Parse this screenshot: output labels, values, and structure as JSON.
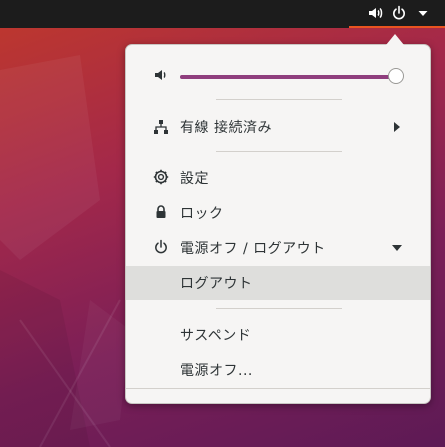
{
  "topbar": {
    "icons": [
      "volume-icon",
      "power-icon",
      "chevron-down-icon"
    ],
    "accent_color": "#e95420",
    "background_color": "#1c1c1c"
  },
  "menu": {
    "volume": {
      "icon": "volume-icon",
      "level": 0.99,
      "fill_color": "#8f3e7d"
    },
    "network": {
      "icon": "network-wired-icon",
      "label": "有線 接続済み"
    },
    "settings": {
      "icon": "settings-icon",
      "label": "設定"
    },
    "lock": {
      "icon": "lock-icon",
      "label": "ロック"
    },
    "power_off_logout": {
      "icon": "power-icon",
      "label": "電源オフ / ログアウト",
      "expanded": true,
      "items": {
        "logout": "ログアウト",
        "suspend": "サスペンド",
        "power_off": "電源オフ..."
      }
    }
  }
}
